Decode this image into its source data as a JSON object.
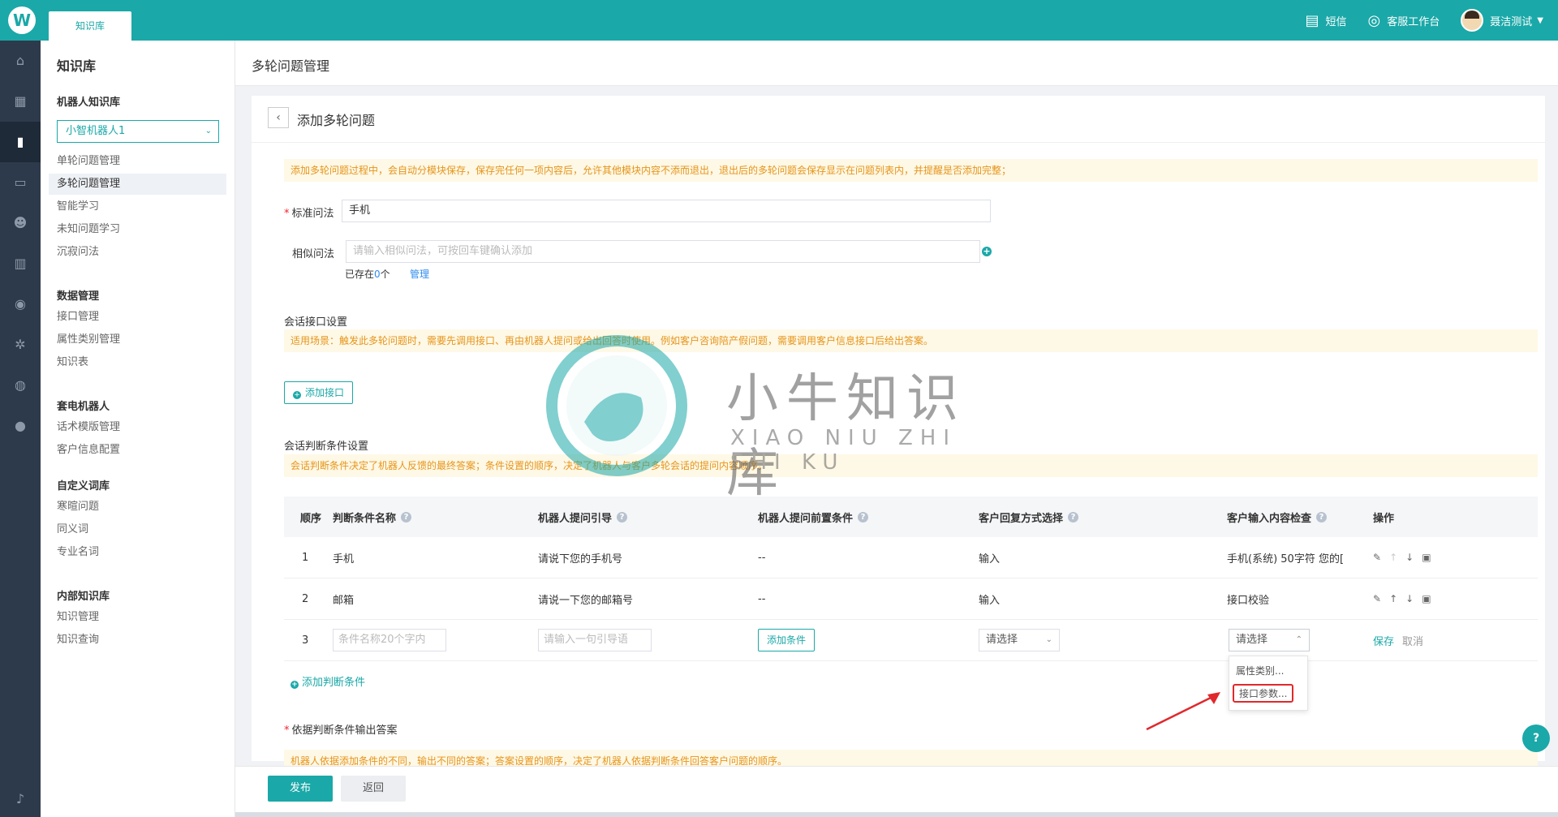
{
  "app": {
    "logo_letter": "W",
    "top_tab": "知识库",
    "top_right": [
      {
        "icon": "chat-icon",
        "glyph": "▤",
        "label": "短信"
      },
      {
        "icon": "headset-icon",
        "glyph": "◎",
        "label": "客服工作台"
      }
    ],
    "user_name": "聂洁测试"
  },
  "rail_icons": [
    "home-icon",
    "apps-icon",
    "book-icon",
    "message-icon",
    "users-icon",
    "chart-icon",
    "search-analytics-icon",
    "settings-icon",
    "robot-icon",
    "account-icon",
    "bell-icon"
  ],
  "sidebar": {
    "title": "知识库",
    "robot_group": "机器人知识库",
    "robot_select": "小智机器人1",
    "robot_items": [
      "单轮问题管理",
      "多轮问题管理",
      "智能学习",
      "未知问题学习",
      "沉寂问法"
    ],
    "data_group": "数据管理",
    "data_items": [
      "接口管理",
      "属性类别管理",
      "知识表"
    ],
    "call_group": "套电机器人",
    "call_items": [
      "话术模版管理",
      "客户信息配置"
    ],
    "custom_group": "自定义词库",
    "custom_items": [
      "寒暄问题",
      "同义词",
      "专业名词"
    ],
    "internal_group": "内部知识库",
    "internal_items": [
      "知识管理",
      "知识查询"
    ]
  },
  "page": {
    "crumb_title": "多轮问题管理",
    "card_title": "添加多轮问题",
    "notice_top": "添加多轮问题过程中，会自动分模块保存，保存完任何一项内容后，允许其他模块内容不添而退出，退出后的多轮问题会保存显示在问题列表内，并提醒是否添加完整；",
    "standard_label": "标准问法",
    "standard_value": "手机",
    "similar_label": "相似问法",
    "similar_placeholder": "请输入相似问法，可按回车键确认添加",
    "exists_prefix": "已存在",
    "exists_count": "0",
    "exists_suffix": "个",
    "manage_link": "管理",
    "session_api_title": "会话接口设置",
    "session_api_notice": "适用场景：触发此多轮问题时，需要先调用接口、再由机器人提问或给出回答时使用。例如客户咨询陪产假问题，需要调用客户信息接口后给出答案。",
    "add_api_button": "添加接口",
    "condition_title": "会话判断条件设置",
    "condition_notice": "会话判断条件决定了机器人反馈的最终答案；条件设置的顺序，决定了机器人与客户多轮会话的提问内容顺序。",
    "add_condition_link": "添加判断条件",
    "answer_title": "依据判断条件输出答案",
    "answer_notice": "机器人依据添加条件的不同，输出不同的答案；答案设置的顺序，决定了机器人依据判断条件回答客户问题的顺序。"
  },
  "table": {
    "headers": [
      "顺序",
      "判断条件名称",
      "机器人提问引导",
      "机器人提问前置条件",
      "客户回复方式选择",
      "客户输入内容检查",
      "操作"
    ],
    "rows": [
      {
        "seq": "1",
        "name": "手机",
        "guide": "请说下您的手机号",
        "precond": "--",
        "reply": "输入",
        "check": "手机(系统) 50字符 您的["
      },
      {
        "seq": "2",
        "name": "邮箱",
        "guide": "请说一下您的邮箱号",
        "precond": "--",
        "reply": "输入",
        "check": "接口校验"
      }
    ],
    "new_row": {
      "seq": "3",
      "name_placeholder": "条件名称20个字内",
      "guide_placeholder": "请输入一句引导语",
      "add_condition": "添加条件",
      "reply_select": "请选择",
      "check_select": "请选择",
      "save": "保存",
      "cancel": "取消"
    },
    "dropdown_options": [
      "属性类别...",
      "接口参数..."
    ]
  },
  "footer": {
    "publish": "发布",
    "back": "返回"
  },
  "help_fab": "?",
  "watermark": {
    "text": "小牛知识库",
    "sub": "XIAO NIU ZHI SHI KU"
  },
  "colors": {
    "brand": "#1ba8a8",
    "notice_bg": "#fef8e6",
    "notice_text": "#e6951a",
    "highlight_red": "#e0292d"
  }
}
